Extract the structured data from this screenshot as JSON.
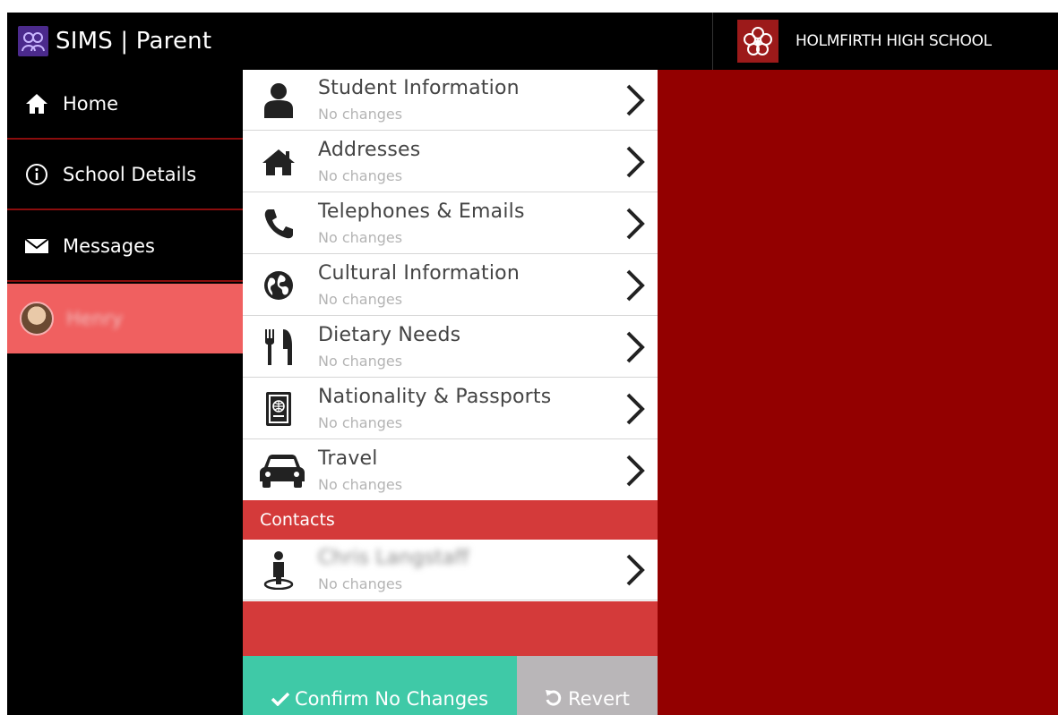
{
  "app": {
    "title": "SIMS | Parent"
  },
  "school": {
    "name": "HOLMFIRTH HIGH SCHOOL"
  },
  "sidebar": {
    "items": [
      {
        "label": "Home",
        "icon": "home-icon"
      },
      {
        "label": "School Details",
        "icon": "info-icon"
      },
      {
        "label": "Messages",
        "icon": "envelope-icon"
      }
    ],
    "student": {
      "name": "Henry",
      "icon": "avatar"
    }
  },
  "sections": [
    {
      "title": "Student Information",
      "status": "No changes",
      "icon": "person-icon"
    },
    {
      "title": "Addresses",
      "status": "No changes",
      "icon": "house-icon"
    },
    {
      "title": "Telephones & Emails",
      "status": "No changes",
      "icon": "phone-icon"
    },
    {
      "title": "Cultural Information",
      "status": "No changes",
      "icon": "globe-icon"
    },
    {
      "title": "Dietary Needs",
      "status": "No changes",
      "icon": "cutlery-icon"
    },
    {
      "title": "Nationality & Passports",
      "status": "No changes",
      "icon": "passport-icon"
    },
    {
      "title": "Travel",
      "status": "No changes",
      "icon": "car-icon"
    }
  ],
  "contacts": {
    "heading": "Contacts",
    "items": [
      {
        "name": "Chris Langstaff",
        "status": "No changes",
        "icon": "contact-person-icon"
      }
    ]
  },
  "actions": {
    "confirm_label": "Confirm No Changes",
    "revert_label": "Revert"
  },
  "colors": {
    "header_bg": "#000000",
    "sidebar_border": "#8b0d0d",
    "active_item": "#f06060",
    "section_head": "#d43a3a",
    "right_panel": "#930000",
    "confirm": "#3fc9a7",
    "revert": "#b9b6b8"
  }
}
